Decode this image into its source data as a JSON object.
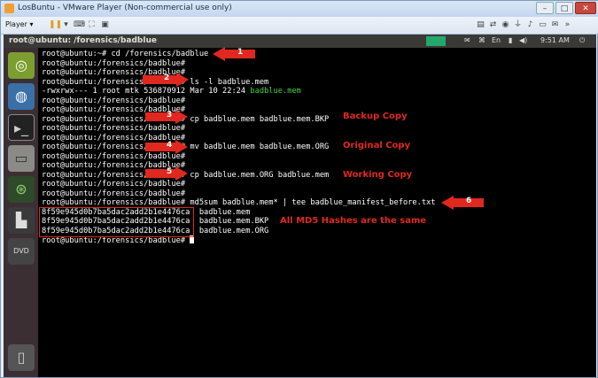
{
  "window": {
    "title": "LosBuntu - VMware Player (Non-commercial use only)",
    "min": "–",
    "max": "□",
    "close": "✕"
  },
  "toolbar": {
    "player_menu": "Player ▾",
    "icons": [
      "pause-icon",
      "send-keys-icon",
      "fullscreen-icon",
      "unity-icon"
    ]
  },
  "vm": {
    "title": "root@ubuntu: /forensics/badblue",
    "tray": {
      "keyboard": "En",
      "volume": "◀)",
      "time": "9:51 AM",
      "power": "⏻"
    }
  },
  "terminal": {
    "lines": [
      "root@ubuntu:~# cd /forensics/badblue",
      "root@ubuntu:/forensics/badblue#",
      "root@ubuntu:/forensics/badblue#",
      "root@ubuntu:/forensics/badblue# ls -l badblue.mem",
      "-rwxrwx--- 1 root mtk 536870912 Mar 10 22:24 ",
      "root@ubuntu:/forensics/badblue#",
      "root@ubuntu:/forensics/badblue#",
      "root@ubuntu:/forensics/badblue# cp badblue.mem badblue.mem.BKP",
      "root@ubuntu:/forensics/badblue#",
      "root@ubuntu:/forensics/badblue#",
      "root@ubuntu:/forensics/badblue# mv badblue.mem badblue.mem.ORG",
      "root@ubuntu:/forensics/badblue#",
      "root@ubuntu:/forensics/badblue#",
      "root@ubuntu:/forensics/badblue# cp badblue.mem.ORG badblue.mem",
      "root@ubuntu:/forensics/badblue#",
      "root@ubuntu:/forensics/badblue#",
      "root@ubuntu:/forensics/badblue# md5sum badblue.mem* | tee badblue_manifest_before.txt",
      "8f59e945d0b7ba5dac2add2b1e4476ca  badblue.mem",
      "8f59e945d0b7ba5dac2add2b1e4476ca  badblue.mem.BKP",
      "8f59e945d0b7ba5dac2add2b1e4476ca  badblue.mem.ORG",
      "root@ubuntu:/forensics/badblue# "
    ],
    "ls_filename": "badblue.mem"
  },
  "annotations": {
    "arrows": [
      "1",
      "2",
      "3",
      "4",
      "5",
      "6"
    ],
    "labels": {
      "backup": "Backup Copy",
      "original": "Original Copy",
      "working": "Working Copy",
      "hashes": "All MD5 Hashes are the same"
    }
  }
}
